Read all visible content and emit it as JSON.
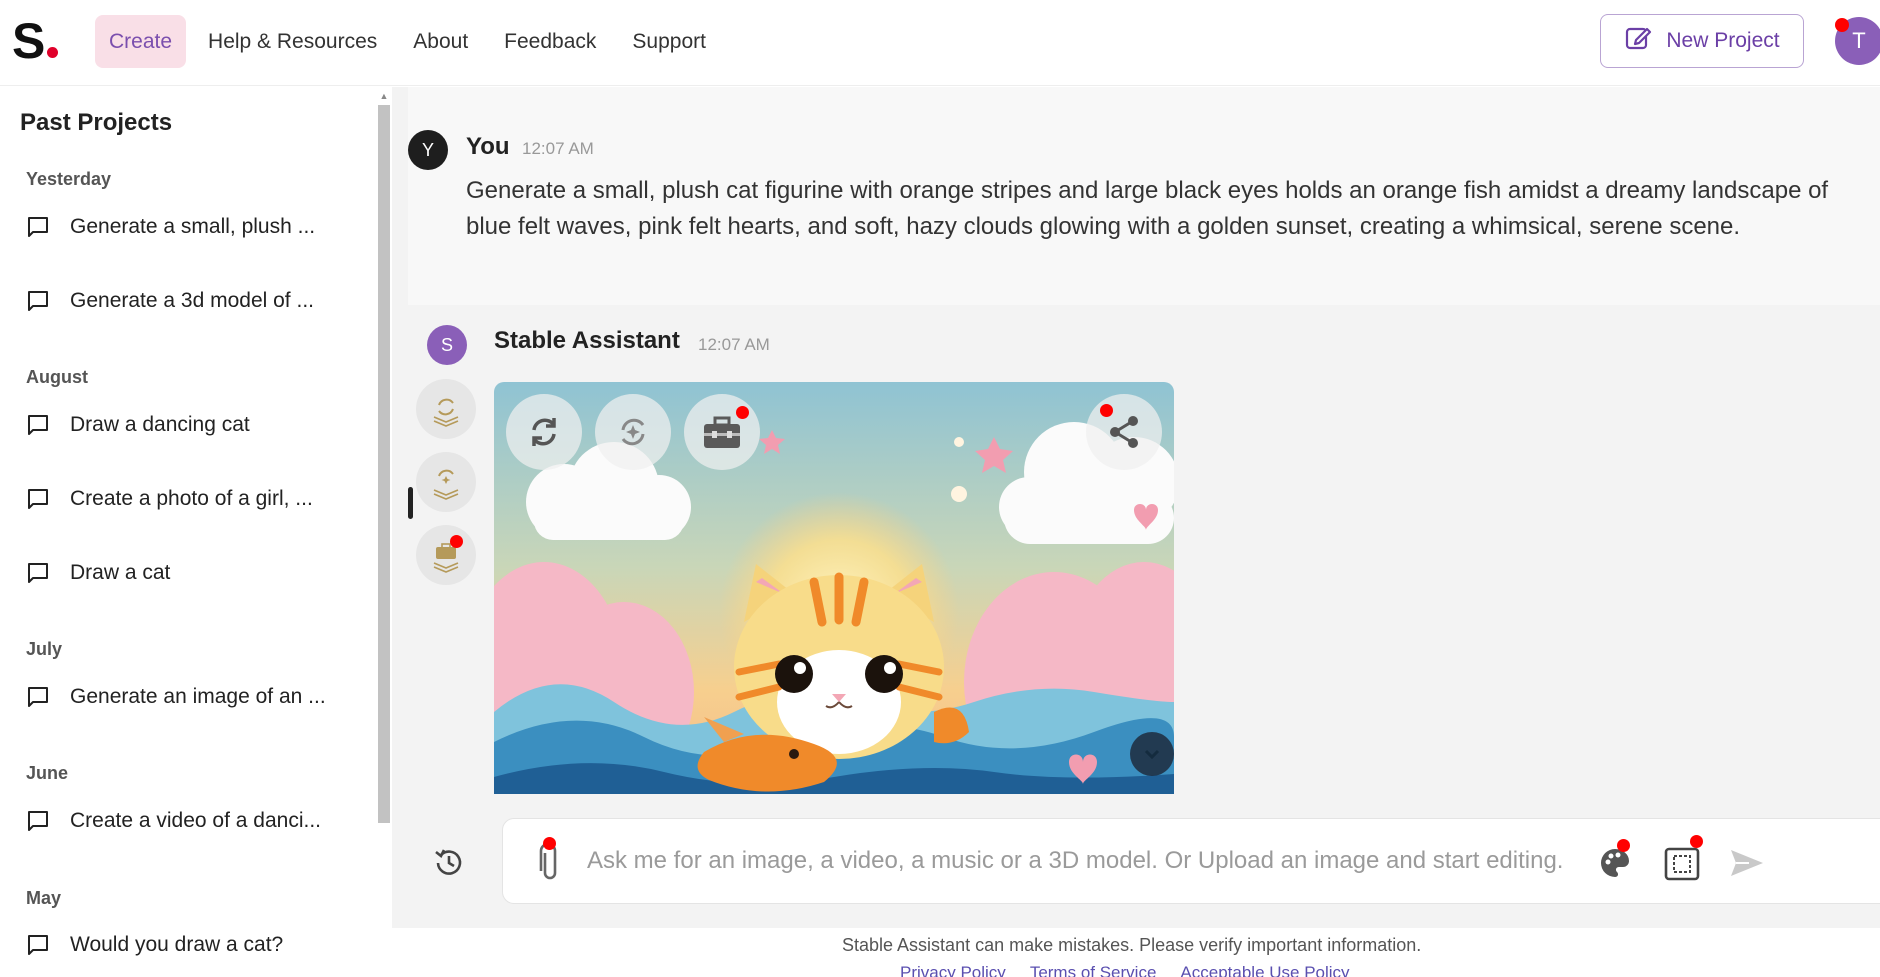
{
  "header": {
    "logo_text": "S",
    "nav": [
      "Create",
      "Help & Resources",
      "About",
      "Feedback",
      "Support"
    ],
    "new_project_label": "New Project",
    "user_initial": "T",
    "colors": {
      "accent": "#7b4fae",
      "active_nav_bg": "#f9dfe7",
      "logo_dot": "#e0002a"
    }
  },
  "sidebar": {
    "title": "Past Projects",
    "groups": [
      {
        "label": "Yesterday",
        "items": [
          "Generate a small, plush ...",
          "Generate a 3d model of ..."
        ]
      },
      {
        "label": "August",
        "items": [
          "Draw a dancing cat",
          "Create a photo of a girl, ...",
          "Draw a cat"
        ]
      },
      {
        "label": "July",
        "items": [
          "Generate an image of an ..."
        ]
      },
      {
        "label": "June",
        "items": [
          "Create a video of a danci..."
        ]
      },
      {
        "label": "May",
        "items": [
          "Would you draw a cat?"
        ]
      }
    ]
  },
  "chat": {
    "user_message": {
      "avatar_initial": "Y",
      "name": "You",
      "time": "12:07 AM",
      "text": "Generate a small, plush cat figurine with orange stripes and large black eyes holds an orange fish amidst a dreamy landscape of blue felt waves, pink felt hearts, and soft, hazy clouds glowing with a golden sunset, creating a whimsical, serene scene."
    },
    "assistant_message": {
      "avatar_initial": "S",
      "name": "Stable Assistant",
      "time": "12:07 AM",
      "image_icons": [
        "regenerate-icon",
        "variation-icon",
        "toolbox-icon",
        "share-icon"
      ]
    },
    "side_tools": [
      "regenerate-stack-icon",
      "variation-stack-icon",
      "toolbox-stack-icon"
    ]
  },
  "composer": {
    "placeholder": "Ask me for an image, a video, a music or a 3D model. Or Upload an image and start editing.",
    "value": "",
    "icons": [
      "history-icon",
      "paperclip-icon",
      "palette-icon",
      "crop-icon",
      "send-icon"
    ]
  },
  "footer": {
    "disclaimer": "Stable Assistant can make mistakes. Please verify important information.",
    "links": [
      "Privacy Policy",
      "Terms of Service",
      "Acceptable Use Policy"
    ]
  }
}
